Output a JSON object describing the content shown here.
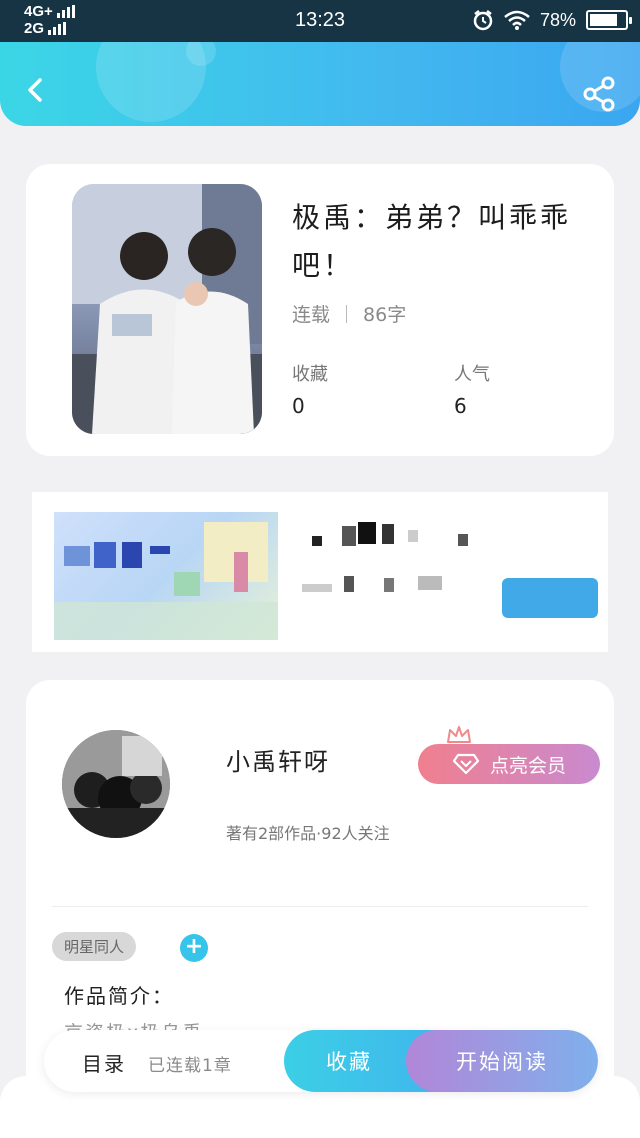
{
  "status_bar": {
    "network_top": "4G+",
    "network_bottom": "2G",
    "time": "13:23",
    "battery": "78%",
    "battery_level": 0.78,
    "icons": [
      "alarm-icon",
      "wifi-icon",
      "battery-icon"
    ]
  },
  "header": {
    "back_icon": "chevron-left-icon",
    "share_icon": "share-icon"
  },
  "book": {
    "title": "极禹：弟弟？叫乖乖吧！",
    "status": "连载",
    "word_count": "86字",
    "favorites_label": "收藏",
    "favorites_value": "0",
    "popularity_label": "人气",
    "popularity_value": "6"
  },
  "author": {
    "name": "小禹轩呀",
    "info": "著有2部作品·92人关注",
    "vip_button": "点亮会员"
  },
  "tags": [
    "明星同人"
  ],
  "add_tag_label": "+",
  "intro": {
    "label": "作品简介：",
    "text": "京瓷极x极乌禹"
  },
  "bottom_bar": {
    "toc": "目录",
    "chapters": "已连载1章",
    "collect": "收藏",
    "read": "开始阅读"
  },
  "colors": {
    "header_start": "#3bd6e6",
    "header_end": "#3aa6f0",
    "vip_start": "#f07f8e",
    "vip_end": "#c98ad0",
    "accent_blue": "#36c4ea"
  }
}
